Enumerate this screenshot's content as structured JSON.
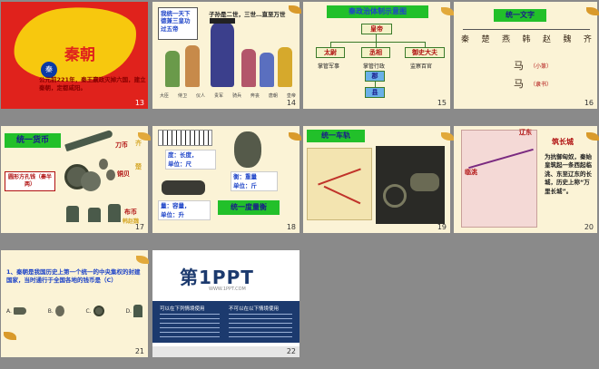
{
  "slides": [
    {
      "number": "13",
      "title": "秦朝",
      "badge": "秦",
      "caption": "公元前221年，秦王嬴政灭掉六国，建立秦朝，定都咸阳。"
    },
    {
      "number": "14",
      "speech": "我统一天下德兼三皇功过五帝",
      "quote": "子孙是二世，三世…直至万世",
      "labels": [
        "大臣",
        "侍卫",
        "仪人",
        "贵军",
        "骑兵",
        "奔丧",
        "唐朝",
        "皇帝"
      ]
    },
    {
      "number": "15",
      "title": "秦政治体制示意图",
      "emperor": "皇帝",
      "officials": [
        {
          "name": "太尉",
          "duty": "掌管军事"
        },
        {
          "name": "丞相",
          "duty": "掌管行政"
        },
        {
          "name": "御史大夫",
          "duty": "监察百官"
        }
      ],
      "commandery": "郡",
      "county": "县"
    },
    {
      "number": "16",
      "title": "统一文字",
      "scripts": [
        "秦",
        "楚",
        "燕",
        "韩",
        "赵",
        "魏",
        "齐",
        "马"
      ],
      "small_seal": "（小篆）",
      "clerical": "（隶书）"
    },
    {
      "number": "17",
      "title": "统一货币",
      "knife": "刀币",
      "state_qi": "齐",
      "shell": "铜贝",
      "state_chu": "楚",
      "round_coin_label": "圆形方孔钱（秦半两）",
      "spade": "布币",
      "state_han_wei": "韩赵魏"
    },
    {
      "number": "18",
      "len": "度：长度，",
      "len_unit": "单位：尺",
      "weight": "衡：重量",
      "weight_unit": "单位：斤",
      "vol": "量：容量，",
      "vol_unit": "单位：升",
      "banner": "统一度量衡"
    },
    {
      "number": "19",
      "title": "统一车轨"
    },
    {
      "number": "20",
      "wall": "筑长城",
      "liaodong": "辽东",
      "lintao": "临洮",
      "text": "为抗御匈奴，秦始皇筑起一条西起临洮、东至辽东的长城，历史上称“万里长城”。"
    },
    {
      "number": "21",
      "question": "1、秦朝是我国历史上第一个统一的中央集权的封建国家，当时通行于全国各地的钱币是（C）",
      "options": [
        "A.",
        "B.",
        "C.",
        "D."
      ]
    },
    {
      "number": "22",
      "brand": "第1PPT",
      "brand_sub": "WWW.1PPT.COM",
      "left_heading": "可以在下列情境使用",
      "right_heading": "不可以在以下情境使用"
    }
  ],
  "colors": {
    "slide_red": "#d5221c",
    "slide_green": "#22c02a",
    "slide_blue": "#1e44c8",
    "map_yellow": "#f7c80e"
  }
}
